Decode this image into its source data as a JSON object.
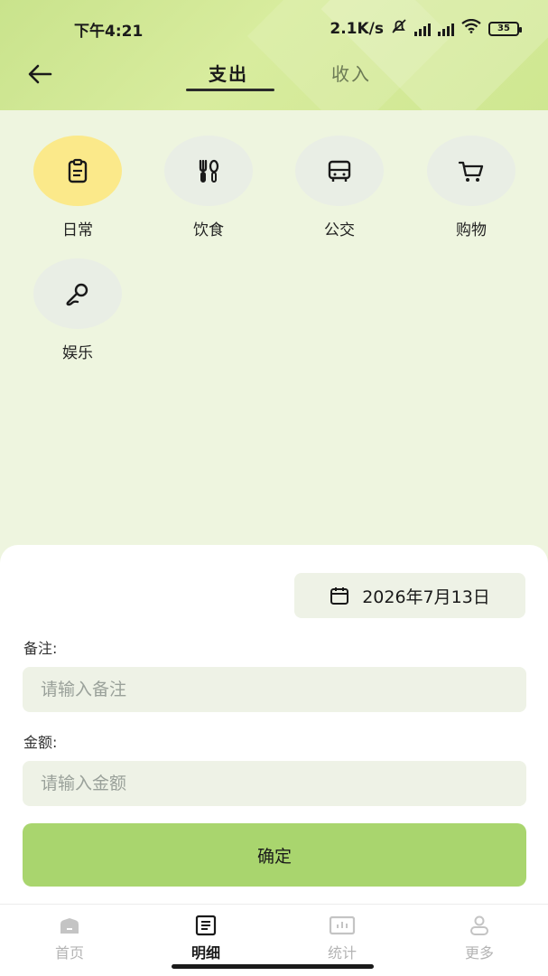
{
  "status_bar": {
    "time": "下午4:21",
    "network_speed": "2.1K/s",
    "battery": "35"
  },
  "header": {
    "back_icon": "arrow-left-icon",
    "tabs": [
      {
        "label": "支出",
        "active": true
      },
      {
        "label": "收入",
        "active": false
      }
    ]
  },
  "categories": [
    {
      "label": "日常",
      "icon": "clipboard-icon",
      "selected": true
    },
    {
      "label": "饮食",
      "icon": "utensils-icon",
      "selected": false
    },
    {
      "label": "公交",
      "icon": "bus-icon",
      "selected": false
    },
    {
      "label": "购物",
      "icon": "cart-icon",
      "selected": false
    },
    {
      "label": "娱乐",
      "icon": "microphone-icon",
      "selected": false
    }
  ],
  "form": {
    "date": "2026年7月13日",
    "note_label": "备注:",
    "note_placeholder": "请输入备注",
    "amount_label": "金额:",
    "amount_placeholder": "请输入金额",
    "confirm_label": "确定"
  },
  "bottom_nav": [
    {
      "label": "首页",
      "icon": "home-icon",
      "active": false
    },
    {
      "label": "明细",
      "icon": "list-icon",
      "active": true
    },
    {
      "label": "统计",
      "icon": "chart-icon",
      "active": false
    },
    {
      "label": "更多",
      "icon": "user-icon",
      "active": false
    }
  ],
  "colors": {
    "accent": "#a9d56e",
    "header": "#cfe791",
    "selected_category": "#fbe98a",
    "background": "#eef5df"
  }
}
